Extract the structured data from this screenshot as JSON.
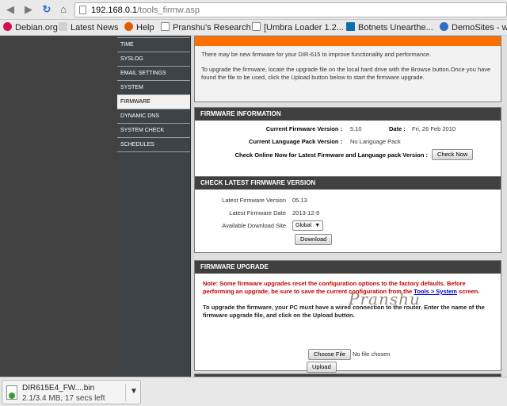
{
  "browser": {
    "url_host": "192.168.0.1",
    "url_path": "/tools_firmw.asp",
    "bookmarks": [
      {
        "label": "Debian.org",
        "icon": "debian-icon",
        "color": "#d70a53"
      },
      {
        "label": "Latest News",
        "icon": "rss-icon",
        "color": "#d0d0d0"
      },
      {
        "label": "Help",
        "icon": "help-icon",
        "color": "#e05a00"
      },
      {
        "label": "Pranshu's Research",
        "icon": "page-icon",
        "color": "#ffffff"
      },
      {
        "label": "[Umbra Loader 1.2...",
        "icon": "page-icon",
        "color": "#ffffff"
      },
      {
        "label": "Botnets Unearthe...",
        "icon": "site-icon",
        "color": "#0b6fb2"
      },
      {
        "label": "DemoSites - w...",
        "icon": "site-icon",
        "color": "#2f6fc2"
      }
    ]
  },
  "sidebar": {
    "items": [
      {
        "label": "Time",
        "active": false
      },
      {
        "label": "Syslog",
        "active": false
      },
      {
        "label": "Email Settings",
        "active": false
      },
      {
        "label": "System",
        "active": false
      },
      {
        "label": "Firmware",
        "active": true
      },
      {
        "label": "Dynamic DNS",
        "active": false
      },
      {
        "label": "System Check",
        "active": false
      },
      {
        "label": "Schedules",
        "active": false
      }
    ]
  },
  "intro": {
    "line1": "There may be new firmware for your DIR-615 to improve functionality and performance.",
    "line2": "To upgrade the firmware, locate the upgrade file on the local hard drive with the Browse button.Once you have found the file to be used, click the Upload button below to start the firmware upgrade."
  },
  "firmware_info": {
    "title": "Firmware Information",
    "current_version_label": "Current Firmware Version :",
    "current_version": "5.10",
    "date_label": "Date :",
    "date_value": "Fri, 26 Feb 2010",
    "lang_label": "Current Language Pack Version :",
    "lang_value": "No Language Pack",
    "check_online_label": "Check Online Now for Latest Firmware and Language pack Version :",
    "check_now_button": "Check Now"
  },
  "check_latest": {
    "title": "Check Latest Firmware Version",
    "latest_version_label": "Latest Firmware Version",
    "latest_version": "05.13",
    "latest_date_label": "Latest Firmware Date",
    "latest_date": "2013-12-9",
    "download_site_label": "Available Download Site",
    "download_site_value": "Global",
    "download_button": "Download"
  },
  "upgrade": {
    "title": "Firmware Upgrade",
    "note_prefix": "Note: Some firmware upgrades reset the configuration options to the factory defaults. Before performing an upgrade, be sure to save the current configuration from the ",
    "note_link": "Tools > System",
    "note_suffix": " screen.",
    "instructions": "To upgrade the firmware, your PC must have a wired connection to the router. Enter the name of the firmware upgrade file, and click on the Upload button.",
    "choose_file_button": "Choose File",
    "no_file_text": "No file chosen",
    "upload_button": "Upload",
    "watermark": "Pranshu"
  },
  "download_shelf": {
    "filename": "DIR615E4_FW....bin",
    "status": "2.1/3.4 MB, 17 secs left"
  }
}
